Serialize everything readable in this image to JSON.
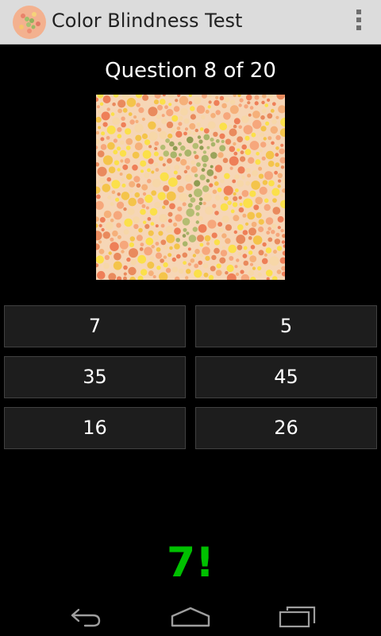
{
  "app": {
    "title": "Color Blindness Test",
    "icon": "ishihara-plate-icon",
    "menu_icon": "overflow-menu-icon"
  },
  "quiz": {
    "question_label": "Question 8 of 20",
    "plate": {
      "depicted_number": "7",
      "background_colors": [
        "#f6a77c",
        "#f4c44a",
        "#e98a5d",
        "#f7d7a8",
        "#f5b07a",
        "#ee7f58",
        "#fbe04a"
      ],
      "figure_colors": [
        "#9aa35b",
        "#a9b56a",
        "#b4bd72",
        "#8f9c52"
      ]
    },
    "answers": [
      {
        "label": "7"
      },
      {
        "label": "5"
      },
      {
        "label": "35"
      },
      {
        "label": "45"
      },
      {
        "label": "16"
      },
      {
        "label": "26"
      }
    ],
    "feedback": "7!",
    "feedback_color": "#00c000"
  },
  "navigation": {
    "back_icon": "back-icon",
    "home_icon": "home-icon",
    "recents_icon": "recents-icon"
  }
}
